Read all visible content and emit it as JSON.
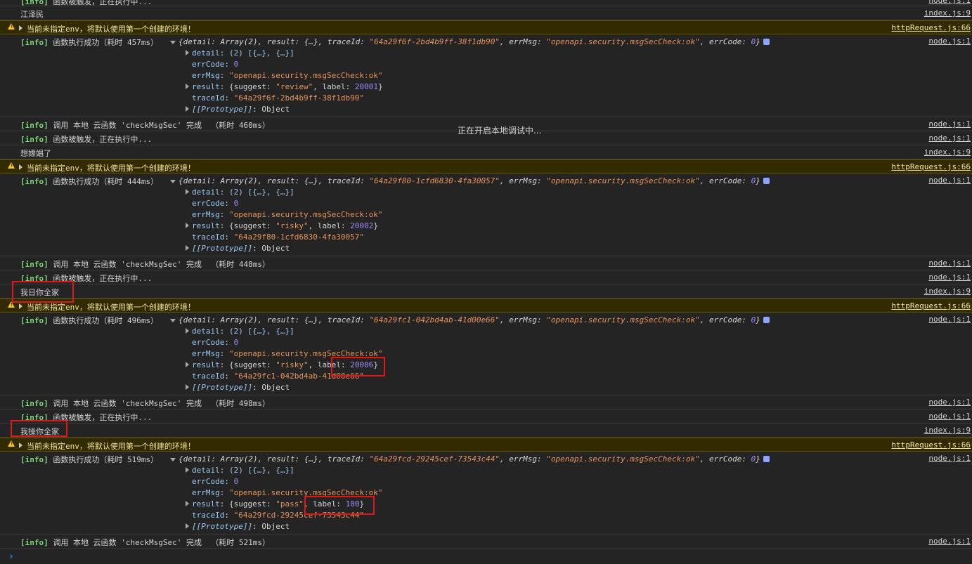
{
  "overlay": "正在开启本地调试中...",
  "src": {
    "node": "node.js:1",
    "index": "index.js:9",
    "http": "httpRequest.js:66"
  },
  "lines": {
    "trigger": "函数被触发，正在执行中...",
    "warn": "当前未指定env，将默认使用第一个创建的环境！",
    "success_457": "函数执行成功（耗时 457ms）",
    "success_444": "函数执行成功（耗时 444ms）",
    "success_496": "函数执行成功（耗时 496ms）",
    "success_519": "函数执行成功（耗时 519ms）",
    "done_460": "调用 本地 云函数 'checkMsgSec' 完成  （耗时 460ms）",
    "done_448": "调用 本地 云函数 'checkMsgSec' 完成  （耗时 448ms）",
    "done_498": "调用 本地 云函数 'checkMsgSec' 完成  （耗时 498ms）",
    "done_521": "调用 本地 云函数 'checkMsgSec' 完成  （耗时 521ms）",
    "tag": "[info]"
  },
  "inputs": [
    "江泽民",
    "想嫖娼了",
    "我日你全家",
    "我操你全家"
  ],
  "objects": [
    {
      "traceId": "64a29f6f-2bd4b9ff-38f1db90",
      "suggest": "review",
      "label": "20001"
    },
    {
      "traceId": "64a29f80-1cfd6830-4fa30057",
      "suggest": "risky",
      "label": "20002"
    },
    {
      "traceId": "64a29fc1-042bd4ab-41d00e66",
      "suggest": "risky",
      "label": "20006"
    },
    {
      "traceId": "64a29fcd-29245cef-73543c44",
      "suggest": "pass",
      "label": "100"
    }
  ],
  "obj_text": {
    "head_pre": "{detail: Array(2), result: {…}, traceId: ",
    "errmsg_key": "errMsg: ",
    "errcode_key": "errCode: ",
    "errmsg_val": "\"openapi.security.msgSecCheck:ok\"",
    "errcode_val": "0",
    "detail": "detail: (2) [{…}, {…}]",
    "proto": "[[Prototype]]",
    "proto_val": ": Object"
  }
}
